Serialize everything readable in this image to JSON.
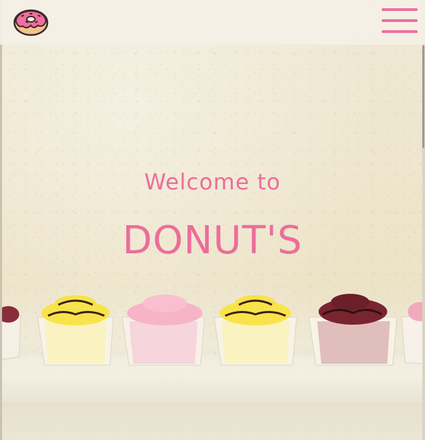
{
  "navbar": {
    "logo_icon": "donut-icon",
    "menu_icon": "hamburger-menu-icon"
  },
  "hero": {
    "welcome_text": "Welcome to",
    "brand_text": "DONUT'S"
  },
  "colors": {
    "accent": "#ec6d9b",
    "navbar_bg": "#f4f0e6",
    "wall": "#eee6cd"
  }
}
